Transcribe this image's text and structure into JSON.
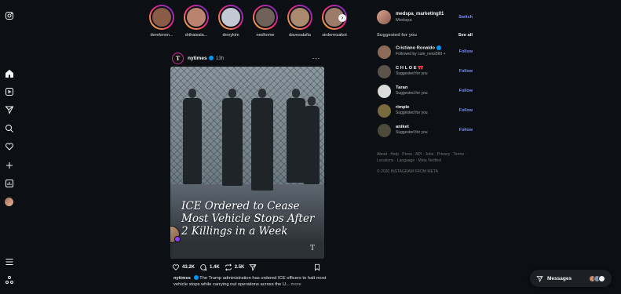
{
  "stories": [
    {
      "username": "derekmon...",
      "color": "#8a5b47"
    },
    {
      "username": "drthaisala...",
      "color": "#b98370"
    },
    {
      "username": "drroykim",
      "color": "#c2c9d2"
    },
    {
      "username": "nedhome",
      "color": "#6f6259"
    },
    {
      "username": "davesalafia",
      "color": "#a98a6e"
    },
    {
      "username": "sirdermzakot",
      "color": "#9c7b6b"
    }
  ],
  "post": {
    "avatar_letter": "T",
    "username": "nytimes",
    "time": "13h",
    "more": "···",
    "headline": "ICE Ordered to Cease Most Vehicle Stops After 2 Killings in a Week",
    "watermark": "T",
    "likes": "43.2K",
    "comments": "1.4K",
    "reposts": "2.5K",
    "caption_user": "nytimes",
    "caption_text": "The Trump administration has ordered ICE officers to halt most vehicle stops while carrying out operations across the U...",
    "caption_more": "more"
  },
  "account": {
    "username": "medspa_marketing01",
    "name": "Medspa",
    "switch_label": "Switch"
  },
  "suggestions_header": {
    "title": "Suggested for you",
    "see_all": "See all"
  },
  "suggestions": [
    {
      "name": "Cristiano Ronaldo",
      "sub": "Followed by cute_ness560 +",
      "follow": "Follow",
      "color": "#8c6a57"
    },
    {
      "name": "C H L O E 🎀",
      "sub": "Suggested for you",
      "follow": "Follow",
      "color": "#5c524c"
    },
    {
      "name": "Taran",
      "sub": "Suggested for you",
      "follow": "Follow",
      "color": "#dbdbdb"
    },
    {
      "name": "rimple",
      "sub": "Suggested for you",
      "follow": "Follow",
      "color": "#7a6a3e"
    },
    {
      "name": "aniket",
      "sub": "Suggested for you",
      "follow": "Follow",
      "color": "#4d4a3a"
    }
  ],
  "footer": {
    "links": "About · Help · Press · API · Jobs · Privacy · Terms · Locations · Language · Meta Verified",
    "copyright": "© 2026 INSTAGRAM FROM META"
  },
  "messages": {
    "label": "Messages",
    "avatar_colors": [
      "#c98d6a",
      "#7b8fa8",
      "#f5f5f5"
    ]
  },
  "nav_icons": [
    "instagram-icon",
    "home-icon",
    "reels-icon",
    "send-icon",
    "search-icon",
    "heart-icon",
    "create-icon",
    "dashboard-icon",
    "profile-avatar",
    "menu-icon",
    "threads-icon"
  ]
}
